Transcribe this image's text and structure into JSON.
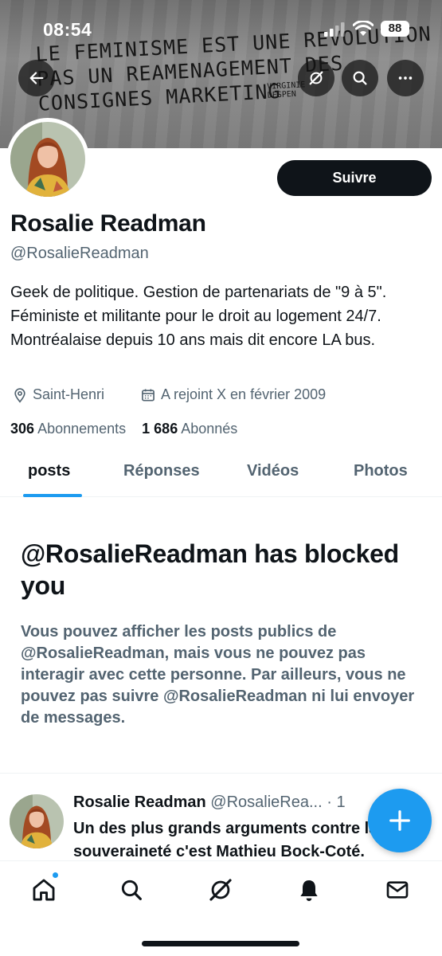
{
  "status_bar": {
    "time": "08:54",
    "battery": "88"
  },
  "banner": {
    "lines": [
      "LE FEMINISME EST UNE REVOLUTION",
      "PAS UN REAMENAGEMENT DES",
      "CONSIGNES MARKETING"
    ],
    "signature_lines": [
      "VIRGINIE",
      "DESPEN"
    ]
  },
  "profile": {
    "follow_label": "Suivre",
    "name": "Rosalie Readman",
    "handle": "@RosalieReadman",
    "bio": "Geek de politique. Gestion de partenariats de \"9 à 5\". Féministe et militante pour le droit au logement 24/7. Montréalaise depuis 10 ans mais dit encore LA bus.",
    "location": "Saint-Henri",
    "joined": "A rejoint X en février 2009",
    "following_count": "306",
    "following_label": "Abonnements",
    "followers_count": "1 686",
    "followers_label": "Abonnés"
  },
  "tabs": [
    {
      "label": "posts",
      "active": true
    },
    {
      "label": "Réponses",
      "active": false
    },
    {
      "label": "Vidéos",
      "active": false
    },
    {
      "label": "Photos",
      "active": false
    }
  ],
  "blocked": {
    "title": "@RosalieReadman has blocked you",
    "description": "Vous pouvez afficher les posts publics de @RosalieReadman, mais vous ne pouvez pas interagir avec cette personne. Par ailleurs, vous ne pouvez pas suivre @RosalieReadman ni lui envoyer de messages."
  },
  "post": {
    "author_name": "Rosalie Readman",
    "author_handle": "@RosalieRea...",
    "separator": "· 1",
    "text": "Un des plus grands arguments contre la souveraineté c'est Mathieu Bock-Coté."
  },
  "colors": {
    "accent": "#1d9bf0",
    "text_primary": "#0f1419",
    "text_secondary": "#536471",
    "follow_button": "#0f1419"
  },
  "icons": {
    "back": "arrow-left-icon",
    "grok": "grok-icon",
    "search": "search-icon",
    "more": "more-icon",
    "location": "location-pin-icon",
    "calendar": "calendar-icon",
    "compose": "plus-icon",
    "nav": [
      "home-icon",
      "search-icon",
      "grok-icon",
      "bell-icon",
      "mail-icon"
    ]
  }
}
